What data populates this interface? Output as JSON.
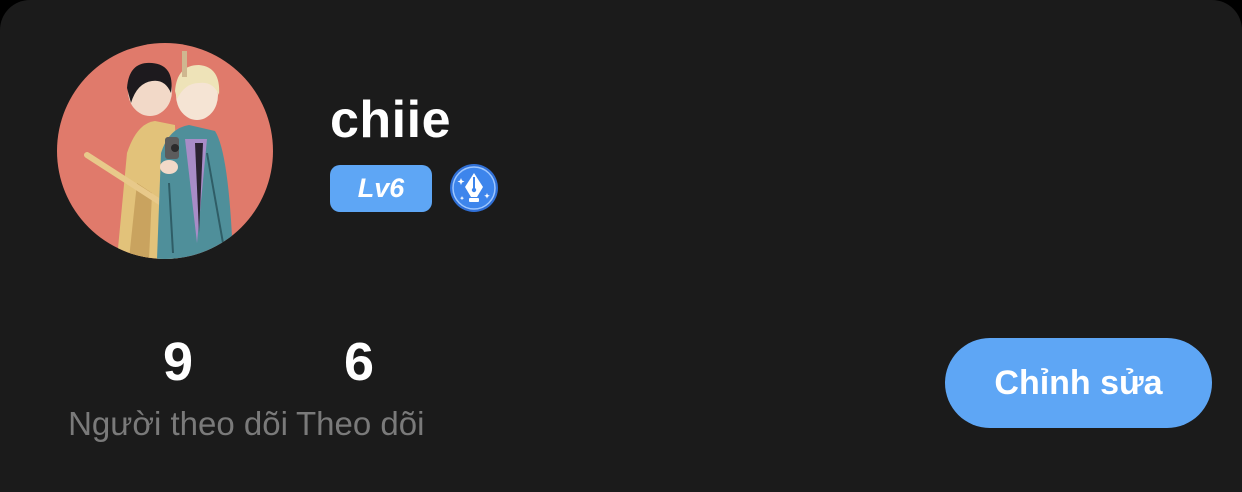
{
  "profile": {
    "username": "chiie",
    "level": "Lv6",
    "badge_icon": "fountain-pen-badge-icon",
    "avatar_icon": "avatar-illustration"
  },
  "stats": {
    "followers": {
      "value": "9",
      "label": "Người theo dõi"
    },
    "following": {
      "value": "6",
      "label": "Theo dõi"
    }
  },
  "actions": {
    "edit_label": "Chỉnh sửa"
  },
  "colors": {
    "background": "#1b1b1b",
    "accent": "#5ea6f5",
    "muted_text": "#7a7a7a"
  }
}
